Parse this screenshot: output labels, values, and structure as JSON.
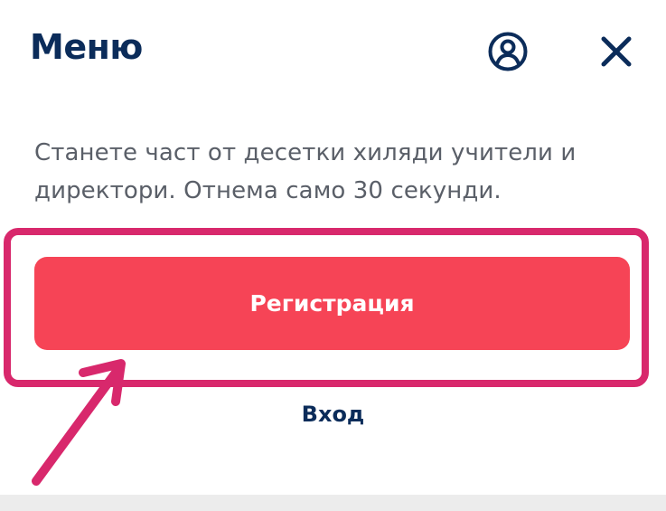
{
  "menu": {
    "title": "Меню",
    "description": "Станете част от десетки хиляди учители и директори. Отнема само 30 секунди.",
    "register_label": "Регистрация",
    "login_label": "Вход"
  },
  "icons": {
    "user": "user-circle-icon",
    "close": "close-icon"
  },
  "colors": {
    "primary_text": "#0b2c5a",
    "accent_button": "#f64456",
    "annotation": "#d8286c",
    "muted_text": "#5a5f68"
  }
}
